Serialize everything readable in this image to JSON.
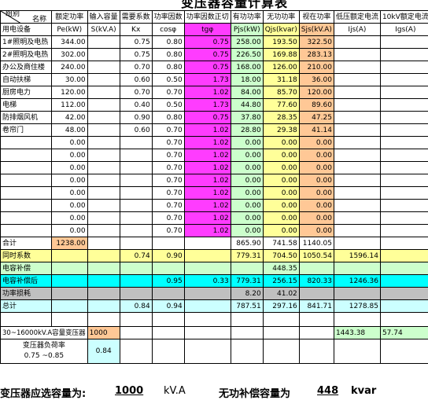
{
  "title": "变压器容量计算表",
  "headers": {
    "name_top": "名称",
    "name_bottom": "组别",
    "pe": "额定功率",
    "s_input": "输入容量",
    "kx": "需要系数",
    "pf": "功率因数",
    "tg": "功率因数正切",
    "p": "有功功率",
    "q": "无功功率",
    "s": "视在功率",
    "ijs": "低压额定电流",
    "i10": "10kV额定电流"
  },
  "units_row": [
    "用电设备",
    "Pe(kW)",
    "S(kV.A)",
    "Kx",
    "cosφ",
    "tgφ",
    "Pjs(kW)",
    "Qjs(kvar)",
    "Sjs(kV.A)",
    "Ijs(A)",
    "Igs(A)"
  ],
  "rows": [
    [
      "1#照明及电热",
      "344.00",
      "",
      "0.75",
      "0.80",
      "0.75",
      "258.00",
      "193.50",
      "322.50"
    ],
    [
      "2#照明及电热",
      "302.00",
      "",
      "0.75",
      "0.80",
      "0.75",
      "226.50",
      "169.88",
      "283.13"
    ],
    [
      "办公及商住楼",
      "240.00",
      "",
      "0.70",
      "0.80",
      "0.75",
      "168.00",
      "126.00",
      "210.00"
    ],
    [
      "自动扶梯",
      "30.00",
      "",
      "0.60",
      "0.50",
      "1.73",
      "18.00",
      "31.18",
      "36.00"
    ],
    [
      "厨房电力",
      "120.00",
      "",
      "0.70",
      "0.70",
      "1.02",
      "84.00",
      "85.70",
      "120.00"
    ],
    [
      "电梯",
      "112.00",
      "",
      "0.40",
      "0.50",
      "1.73",
      "44.80",
      "77.60",
      "89.60"
    ],
    [
      "防排烟风机",
      "42.00",
      "",
      "0.90",
      "0.80",
      "0.75",
      "37.80",
      "28.35",
      "47.25"
    ],
    [
      "卷帘门",
      "48.00",
      "",
      "0.60",
      "0.70",
      "1.02",
      "28.80",
      "29.38",
      "41.14"
    ],
    [
      "",
      "0.00",
      "",
      "",
      "0.70",
      "1.02",
      "0.00",
      "0.00",
      "0.00"
    ],
    [
      "",
      "0.00",
      "",
      "",
      "0.70",
      "1.02",
      "0.00",
      "0.00",
      "0.00"
    ],
    [
      "",
      "0.00",
      "",
      "",
      "0.70",
      "1.02",
      "0.00",
      "0.00",
      "0.00"
    ],
    [
      "",
      "0.00",
      "",
      "",
      "0.70",
      "1.02",
      "0.00",
      "0.00",
      "0.00"
    ],
    [
      "",
      "0.00",
      "",
      "",
      "0.70",
      "1.02",
      "0.00",
      "0.00",
      "0.00"
    ],
    [
      "",
      "0.00",
      "",
      "",
      "0.70",
      "1.02",
      "0.00",
      "0.00",
      "0.00"
    ],
    [
      "",
      "0.00",
      "",
      "",
      "0.70",
      "1.02",
      "0.00",
      "0.00",
      "0.00"
    ],
    [
      "",
      "0.00",
      "",
      "",
      "0.70",
      "1.02",
      "0.00",
      "0.00",
      "0.00"
    ]
  ],
  "summary": {
    "total_label": "合计",
    "total_pe": "1238.00",
    "total_p": "865.90",
    "total_q": "741.58",
    "total_s": "1140.05",
    "sim_label": "同时系数",
    "sim_kx": "0.74",
    "sim_pf": "0.90",
    "sim_p": "779.31",
    "sim_q": "704.50",
    "sim_s": "1050.54",
    "sim_i": "1596.14",
    "comp_label": "电容补偿",
    "comp_q": "448.35",
    "after_label": "电容补偿后",
    "after_pf": "0.95",
    "after_tg": "0.33",
    "after_p": "779.31",
    "after_q": "256.15",
    "after_s": "820.33",
    "after_i": "1246.36",
    "loss_label": "功率损耗",
    "loss_p": "8.20",
    "loss_q": "41.02",
    "grand_label": "总计",
    "grand_kx": "0.84",
    "grand_pf": "0.94",
    "grand_p": "787.51",
    "grand_q": "297.16",
    "grand_s": "841.71",
    "grand_i": "1278.85"
  },
  "transformer": {
    "label": "30~16000kV.A容量变压器",
    "capacity": "1000",
    "i_low": "1443.38",
    "i_high": "57.74",
    "load_label_1": "变压器负荷率",
    "load_label_2": "0.75 ~0.85",
    "load_rate": "0.84"
  },
  "bottom": {
    "sel_label": "变压器应选容量为:",
    "sel_value": "1000",
    "sel_unit": "kV.A",
    "comp_label": "无功补偿容量为",
    "comp_value": "448",
    "comp_unit": "kvar"
  }
}
